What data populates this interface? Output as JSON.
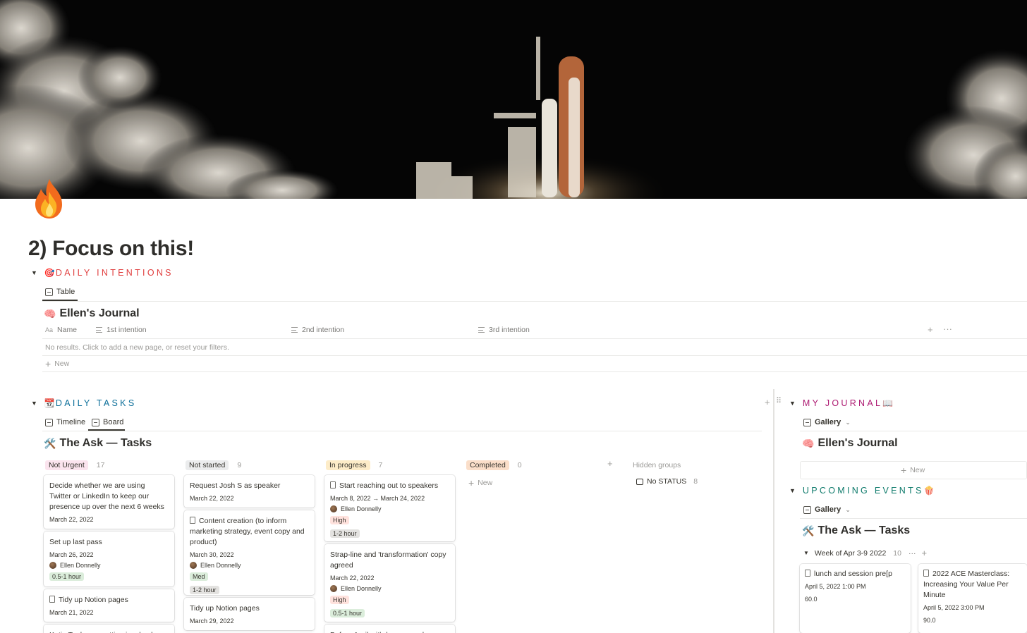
{
  "page": {
    "title": "2) Focus on this!",
    "icon": "fire-emoji"
  },
  "daily_intentions": {
    "heading": "DAILY INTENTIONS",
    "emoji": "🎯",
    "color": "#e03e3e",
    "tab_label": "Table",
    "db_title": "Ellen's Journal",
    "db_emoji": "🧠",
    "columns": [
      "Name",
      "1st intention",
      "2nd intention",
      "3rd intention"
    ],
    "empty_message": "No results. Click to add a new page, or reset your filters.",
    "new_label": "New"
  },
  "daily_tasks": {
    "heading": "DAILY TASKS",
    "emoji": "📆",
    "color": "#0b6e99",
    "tabs": [
      "Timeline",
      "Board"
    ],
    "db_title": "The Ask — Tasks",
    "db_emoji": "🛠️",
    "groups": [
      {
        "label": "Not Urgent",
        "count": "17",
        "bg": "#fbe4ee",
        "cards": [
          {
            "title": "Decide whether we are using Twitter or LinkedIn to keep our presence up over the next 6 weeks",
            "date": "March 22, 2022"
          },
          {
            "title": "Set up last pass",
            "date": "March 26, 2022",
            "person": "Ellen Donnelly",
            "tags": [
              {
                "text": "0.5-1 hour",
                "bg": "#dbeddb"
              }
            ]
          },
          {
            "title": "Tidy up Notion pages",
            "date": "March 21, 2022",
            "doc": true
          },
          {
            "title": "Katie Tucker re getting involved"
          }
        ]
      },
      {
        "label": "Not started",
        "count": "9",
        "bg": "#ebeced",
        "cards": [
          {
            "title": "Request Josh S as speaker",
            "date": "March 22, 2022"
          },
          {
            "title": "Content creation (to inform marketing strategy, event copy and product)",
            "date": "March 30, 2022",
            "person": "Ellen Donnelly",
            "doc": true,
            "tags": [
              {
                "text": "Med",
                "bg": "#dbeddb"
              },
              {
                "text": "1-2 hour",
                "bg": "#e3e2e0"
              }
            ]
          },
          {
            "title": "Tidy up Notion pages",
            "date": "March 29, 2022"
          }
        ]
      },
      {
        "label": "In progress",
        "count": "7",
        "bg": "#fdecc8",
        "cards": [
          {
            "title": "Start reaching out to speakers",
            "date": "March 8, 2022 → March 24, 2022",
            "person": "Ellen Donnelly",
            "doc": true,
            "tags": [
              {
                "text": "High",
                "bg": "#ffe2dd"
              },
              {
                "text": "1-2 hour",
                "bg": "#e3e2e0"
              }
            ]
          },
          {
            "title": "Strap-line and 'transformation' copy agreed",
            "date": "March 22, 2022",
            "person": "Ellen Donnelly",
            "tags": [
              {
                "text": "High",
                "bg": "#ffe2dd"
              },
              {
                "text": "0.5-1 hour",
                "bg": "#dbeddb"
              }
            ]
          },
          {
            "title": "Before April withdraw enough"
          }
        ]
      },
      {
        "label": "Completed",
        "count": "0",
        "bg": "#fadec9",
        "cards": []
      }
    ],
    "new_label": "New",
    "hidden_groups_label": "Hidden groups",
    "no_status_label": "No STATUS",
    "no_status_count": "8"
  },
  "my_journal": {
    "heading": "MY JOURNAL",
    "emoji": "📖",
    "color": "#ad1a72",
    "view_label": "Gallery",
    "db_title": "Ellen's Journal",
    "db_emoji": "🧠",
    "new_label": "New"
  },
  "upcoming_events": {
    "heading": "UPCOMING EVENTS",
    "emoji": "🍿",
    "color": "#0f7b6c",
    "view_label": "Gallery",
    "db_title": "The Ask — Tasks",
    "db_emoji": "🛠️",
    "group_label": "Week of Apr 3-9 2022",
    "group_count": "10",
    "cards": [
      {
        "title": "lunch and session pre[p",
        "date": "April 5, 2022 1:00 PM",
        "value": "60.0"
      },
      {
        "title": "2022 ACE Masterclass: Increasing Your Value Per Minute",
        "date": "April 5, 2022 3:00 PM",
        "value": "90.0"
      }
    ]
  }
}
